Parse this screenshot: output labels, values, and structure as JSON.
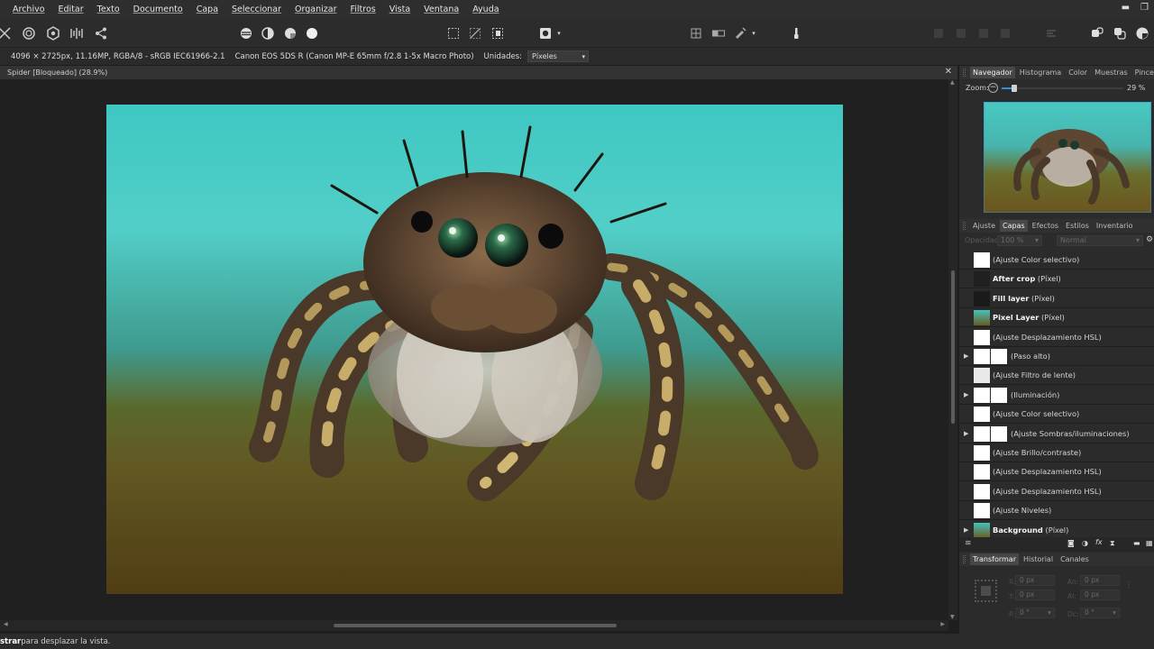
{
  "menu": [
    "Archivo",
    "Editar",
    "Texto",
    "Documento",
    "Capa",
    "Seleccionar",
    "Organizar",
    "Filtros",
    "Vista",
    "Ventana",
    "Ayuda"
  ],
  "window_controls": {
    "minimize": "▬",
    "restore": "❐"
  },
  "contextbar": {
    "image_info": "4096 × 2725px, 11.16MP, RGBA/8 - sRGB IEC61966-2.1",
    "camera": "Canon EOS 5DS R (Canon MP-E 65mm f/2.8 1-5x Macro Photo)",
    "units_label": "Unidades:",
    "units_value": "Píxeles"
  },
  "document_tab": {
    "title": "Spider [Bloqueado] (28.9%)"
  },
  "navigator": {
    "tabs": [
      "Navegador",
      "Histograma",
      "Color",
      "Muestras",
      "Pinceles"
    ],
    "zoom_label": "Zoom:",
    "zoom_value": "29 %",
    "zoom_fraction": 0.29
  },
  "layers_panel": {
    "tabs": [
      "Ajuste",
      "Capas",
      "Efectos",
      "Estilos",
      "Inventario"
    ],
    "opacity_label": "Opacidad:",
    "opacity_value": "100 %",
    "blend_mode": "Normal",
    "layers": [
      {
        "bold": "",
        "name": "(Ajuste Color selectivo)",
        "expand": false,
        "offset": false
      },
      {
        "bold": "After crop",
        "name": " (Píxel)",
        "expand": false,
        "offset": false
      },
      {
        "bold": "Fill layer",
        "name": " (Píxel)",
        "expand": false,
        "offset": false
      },
      {
        "bold": "Pixel Layer",
        "name": " (Píxel)",
        "expand": false,
        "offset": false
      },
      {
        "bold": "",
        "name": "(Ajuste Desplazamiento HSL)",
        "expand": false,
        "offset": false
      },
      {
        "bold": "",
        "name": "(Paso alto)",
        "expand": true,
        "offset": true
      },
      {
        "bold": "",
        "name": "(Ajuste Filtro de lente)",
        "expand": false,
        "offset": false
      },
      {
        "bold": "",
        "name": "(Iluminación)",
        "expand": true,
        "offset": true
      },
      {
        "bold": "",
        "name": "(Ajuste Color selectivo)",
        "expand": false,
        "offset": false
      },
      {
        "bold": "",
        "name": "(Ajuste Sombras/iluminaciones)",
        "expand": true,
        "offset": true
      },
      {
        "bold": "",
        "name": "(Ajuste Brillo/contraste)",
        "expand": false,
        "offset": false
      },
      {
        "bold": "",
        "name": "(Ajuste Desplazamiento HSL)",
        "expand": false,
        "offset": false
      },
      {
        "bold": "",
        "name": "(Ajuste Desplazamiento HSL)",
        "expand": false,
        "offset": false
      },
      {
        "bold": "",
        "name": "(Ajuste Niveles)",
        "expand": false,
        "offset": false
      },
      {
        "bold": "Background",
        "name": " (Píxel)",
        "expand": true,
        "offset": false
      }
    ]
  },
  "transform_panel": {
    "tabs": [
      "Transformar",
      "Historial",
      "Canales"
    ],
    "x_label": "X:",
    "x_value": "0 px",
    "y_label": "Y:",
    "y_value": "0 px",
    "w_label": "An:",
    "w_value": "0 px",
    "h_label": "Al:",
    "h_value": "0 px",
    "r_label": "R:",
    "r_value": "0 °",
    "s_label": "Dc:",
    "s_value": "0 °"
  },
  "statusbar": {
    "bold": "strar",
    "text": " para desplazar la vista."
  },
  "colors": {
    "accent": "#2f8fd8",
    "canvas_bg": "#202020",
    "panel_bg": "#2b2b2b"
  }
}
